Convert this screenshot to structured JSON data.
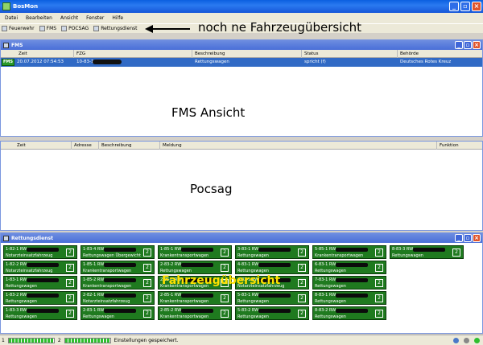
{
  "window": {
    "title": "BosMon"
  },
  "menu": [
    "Datei",
    "Bearbeiten",
    "Ansicht",
    "Fenster",
    "Hilfe"
  ],
  "toolbar": [
    "Feuerwehr",
    "FMS",
    "POCSAG",
    "Rettungsdienst"
  ],
  "annotations": {
    "toolbar_note": "noch ne Fahrzeugübersicht",
    "fms_note": "FMS Ansicht",
    "pocsag_note": "Pocsag",
    "vehicle_note": "Fahrzeugübersicht"
  },
  "fms_panel": {
    "title": "FMS",
    "columns": [
      "Zeit",
      "FZG",
      "Beschreibung",
      "Status",
      "Behörde"
    ],
    "row": {
      "badge": "FMS",
      "zeit": "20.07.2012 07:54:53",
      "fzg": "10-83-1",
      "beschreibung": "Rettungswagen",
      "status": "spricht (f)",
      "behoerde": "Deutsches Rotes Kreuz"
    }
  },
  "pocsag_panel": {
    "columns": [
      "Zeit",
      "Adresse",
      "Beschreibung",
      "Meldung",
      "Funktion"
    ]
  },
  "rd_panel": {
    "title": "Rettungsdienst",
    "tiles": [
      [
        "1-82-1 RW",
        "Notarzteinsatzfahrzeug",
        "2"
      ],
      [
        "1-83-4 RW",
        "Rettungswagen Übergewicht",
        "2"
      ],
      [
        "1-85-1 RW",
        "Krankentransportwagen",
        "2"
      ],
      [
        "3-83-1 RW",
        "Rettungswagen",
        "2"
      ],
      [
        "5-85-1 RW",
        "Krankentransportwagen",
        "2"
      ],
      [
        "8-83-3 RW",
        "Rettungswagen",
        "2"
      ],
      [
        "1-82-2 RW",
        "Notarzteinsatzfahrzeug",
        "2"
      ],
      [
        "1-85-1 RW",
        "Krankentransportwagen",
        "2"
      ],
      [
        "2-83-2 RW",
        "Rettungswagen",
        "2"
      ],
      [
        "4-83-1 RW",
        "Rettungswagen",
        "2"
      ],
      [
        "6-83-1 RW",
        "Rettungswagen",
        "2"
      ],
      [
        "1-83-1 RW",
        "Rettungswagen",
        "2"
      ],
      [
        "1-85-2 RW",
        "Krankentransportwagen",
        "2"
      ],
      [
        "2-85-1 RW",
        "Krankentransportwagen",
        "2"
      ],
      [
        "4-82-1 RW",
        "Notarzteinsatzfahrzeug",
        "2"
      ],
      [
        "7-83-1 RW",
        "Rettungswagen",
        "2"
      ],
      [
        "1-83-2 RW",
        "Rettungswagen",
        "2"
      ],
      [
        "2-82-1 RW",
        "Notarzteinsatzfahrzeug",
        "2"
      ],
      [
        "2-85-1 RW",
        "Krankentransportwagen",
        "2"
      ],
      [
        "5-83-1 RW",
        "Rettungswagen",
        "2"
      ],
      [
        "8-83-1 RW",
        "Rettungswagen",
        "2"
      ],
      [
        "1-83-3 RW",
        "Rettungswagen",
        "2"
      ],
      [
        "2-83-1 RW",
        "Rettungswagen",
        "2"
      ],
      [
        "2-85-2 RW",
        "Krankentransportwagen",
        "2"
      ],
      [
        "5-83-2 RW",
        "Rettungswagen",
        "2"
      ],
      [
        "8-83-2 RW",
        "Rettungswagen",
        "2"
      ]
    ]
  },
  "status": {
    "counter_left": "1",
    "counter_mid": "2",
    "message": "Einstellungen gespeichert."
  }
}
